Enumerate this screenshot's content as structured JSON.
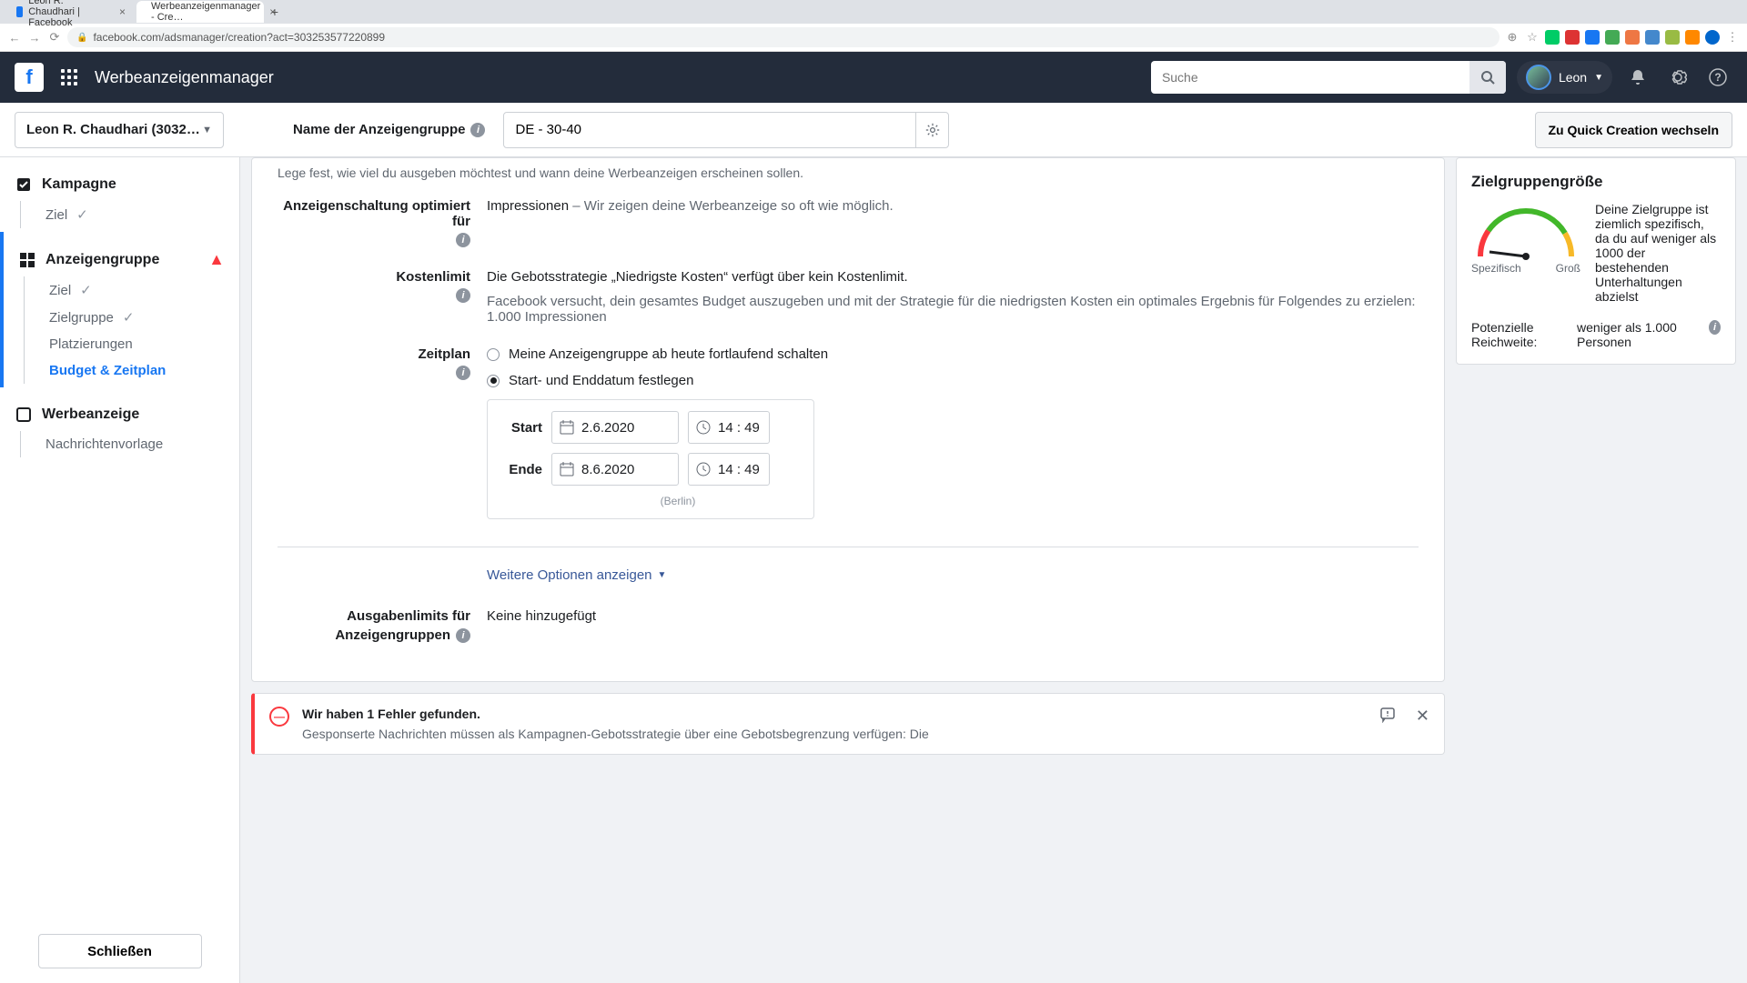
{
  "browser": {
    "tabs": [
      {
        "title": "Leon R. Chaudhari | Facebook"
      },
      {
        "title": "Werbeanzeigenmanager - Cre…"
      }
    ],
    "url": "facebook.com/adsmanager/creation?act=303253577220899"
  },
  "header": {
    "app_title": "Werbeanzeigenmanager",
    "search_placeholder": "Suche",
    "user_name": "Leon"
  },
  "second_bar": {
    "account_name": "Leon R. Chaudhari (3032…",
    "group_name_label": "Name der Anzeigengruppe",
    "group_name_value": "DE - 30-40",
    "quick_btn": "Zu Quick Creation wechseln"
  },
  "sidebar": {
    "campaign": {
      "label": "Kampagne",
      "items": [
        {
          "label": "Ziel",
          "checked": true
        }
      ]
    },
    "adset": {
      "label": "Anzeigengruppe",
      "warn": true,
      "items": [
        {
          "label": "Ziel",
          "checked": true
        },
        {
          "label": "Zielgruppe",
          "checked": true
        },
        {
          "label": "Platzierungen"
        },
        {
          "label": "Budget & Zeitplan",
          "active": true
        }
      ]
    },
    "ad": {
      "label": "Werbeanzeige",
      "items": [
        {
          "label": "Nachrichtenvorlage"
        }
      ]
    },
    "close_btn": "Schließen"
  },
  "form": {
    "intro": "Lege fest, wie viel du ausgeben möchtest und wann deine Werbeanzeigen erscheinen sollen.",
    "opt_label": "Anzeigenschaltung optimiert für",
    "opt_value": "Impressionen",
    "opt_desc": " – Wir zeigen deine Werbeanzeige so oft wie möglich.",
    "cost_label": "Kostenlimit",
    "cost_line1": "Die Gebotsstrategie „Niedrigste Kosten“ verfügt über kein Kostenlimit.",
    "cost_line2": "Facebook versucht, dein gesamtes Budget auszugeben und mit der Strategie für die niedrigsten Kosten ein optimales Ergebnis für Folgendes zu erzielen: 1.000 Impressionen",
    "sched_label": "Zeitplan",
    "radio1": "Meine Anzeigengruppe ab heute fortlaufend schalten",
    "radio2": "Start- und Enddatum festlegen",
    "start_label": "Start",
    "end_label": "Ende",
    "start_date": "2.6.2020",
    "start_time": "14 : 49",
    "end_date": "8.6.2020",
    "end_time": "14 : 49",
    "timezone": "(Berlin)",
    "more_options": "Weitere Optionen anzeigen",
    "spend_label_1": "Ausgabenlimits für",
    "spend_label_2": "Anzeigengruppen",
    "spend_value": "Keine hinzugefügt"
  },
  "error": {
    "title": "Wir haben 1 Fehler gefunden.",
    "desc": "Gesponserte Nachrichten müssen als Kampagnen-Gebotsstrategie über eine Gebotsbegrenzung verfügen: Die"
  },
  "aside": {
    "title": "Zielgruppengröße",
    "gauge_low": "Spezifisch",
    "gauge_high": "Groß",
    "message": "Deine Zielgruppe ist ziemlich spezifisch, da du auf weniger als 1000 der bestehenden Unterhaltungen abzielst",
    "reach_label": "Potenzielle Reichweite:",
    "reach_value": "weniger als 1.000 Personen"
  }
}
